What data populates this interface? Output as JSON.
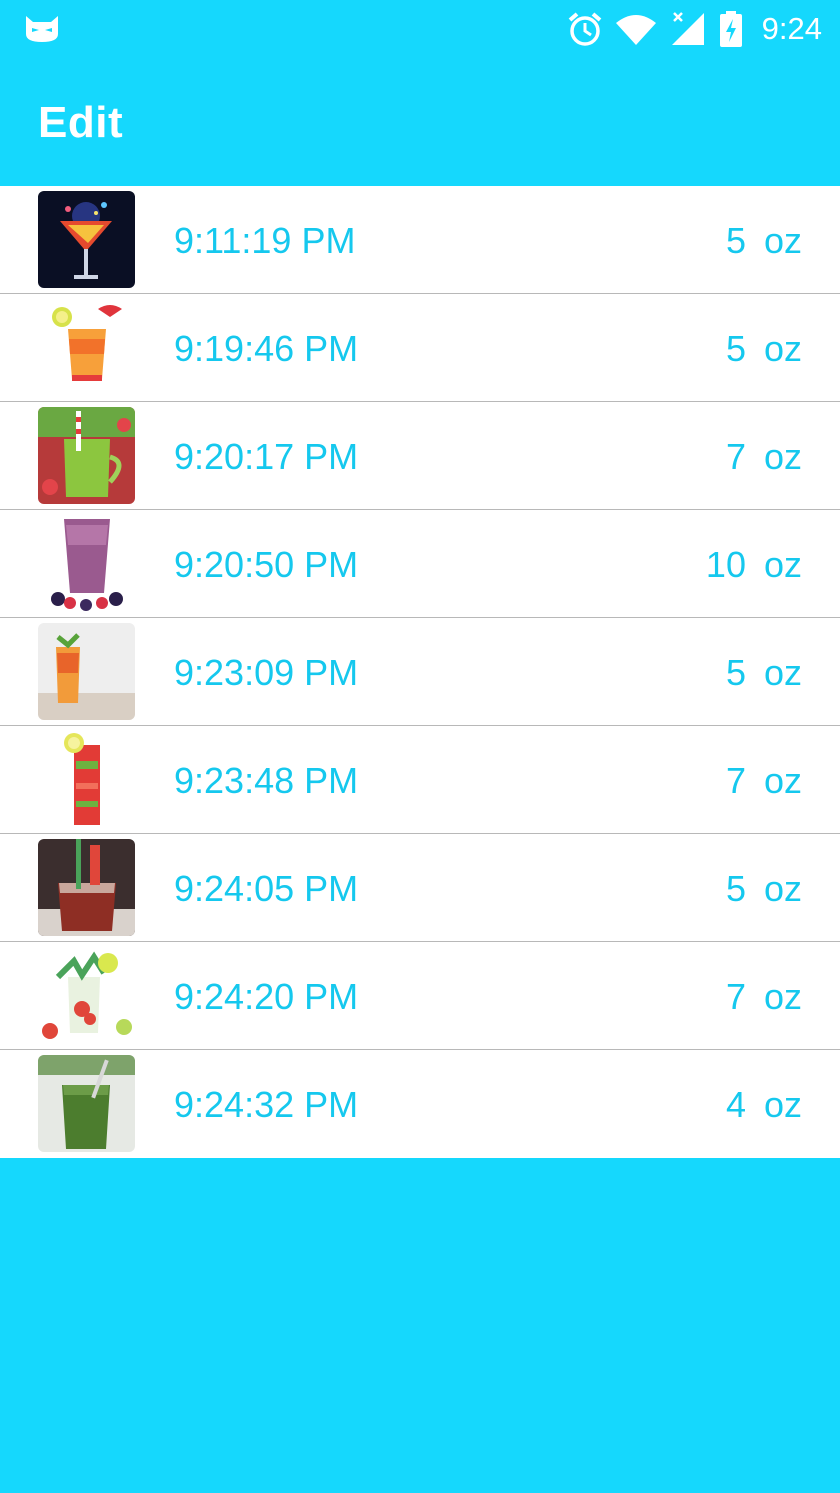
{
  "status_bar": {
    "time": "9:24",
    "icons": [
      "cyanogen-cat-icon",
      "alarm-clock-icon",
      "wifi-icon",
      "cell-signal-icon",
      "battery-charging-icon"
    ]
  },
  "app_bar": {
    "title": "Edit"
  },
  "colors": {
    "primary": "#15d8fd",
    "accent_text": "#15c8ee",
    "divider": "#b8b8b8",
    "list_bg": "#ffffff"
  },
  "entries": [
    {
      "time": "9:11:19 PM",
      "amount": "5",
      "unit": "oz",
      "thumb": "martini-splash"
    },
    {
      "time": "9:19:46 PM",
      "amount": "5",
      "unit": "oz",
      "thumb": "tropical-orange-drink"
    },
    {
      "time": "9:20:17 PM",
      "amount": "7",
      "unit": "oz",
      "thumb": "green-smoothie-jar"
    },
    {
      "time": "9:20:50 PM",
      "amount": "10",
      "unit": "oz",
      "thumb": "berry-smoothie"
    },
    {
      "time": "9:23:09 PM",
      "amount": "5",
      "unit": "oz",
      "thumb": "iced-tea-glass"
    },
    {
      "time": "9:23:48 PM",
      "amount": "7",
      "unit": "oz",
      "thumb": "watermelon-mojito"
    },
    {
      "time": "9:24:05 PM",
      "amount": "5",
      "unit": "oz",
      "thumb": "red-iced-drink"
    },
    {
      "time": "9:24:20 PM",
      "amount": "7",
      "unit": "oz",
      "thumb": "fruit-mojito-spread"
    },
    {
      "time": "9:24:32 PM",
      "amount": "4",
      "unit": "oz",
      "thumb": "green-juice-glass"
    }
  ]
}
